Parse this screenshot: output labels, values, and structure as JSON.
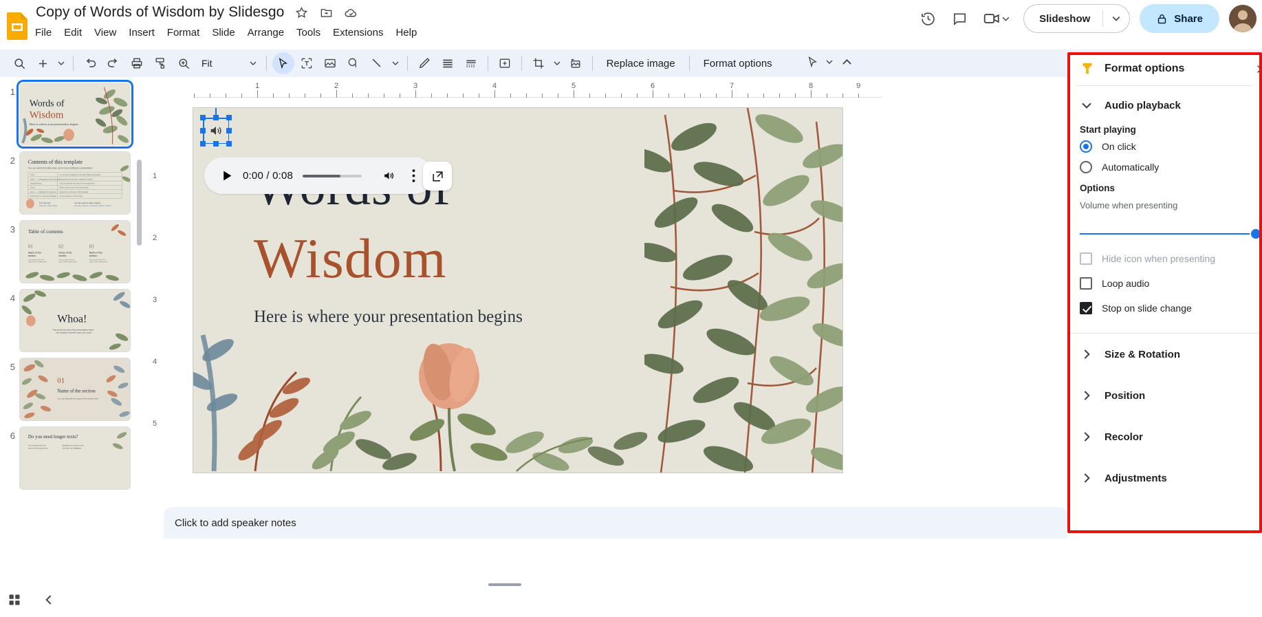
{
  "app": {
    "doc_title": "Copy of Words of Wisdom by Slidesgo",
    "title_icons": [
      "star-icon",
      "move-to-folder-icon",
      "cloud-saved-icon"
    ],
    "menus": [
      "File",
      "Edit",
      "View",
      "Insert",
      "Format",
      "Slide",
      "Arrange",
      "Tools",
      "Extensions",
      "Help"
    ],
    "top_right": {
      "history_icon": "version-history-icon",
      "comment_icon": "comment-icon",
      "meet_icon": "meet-camera-icon",
      "slideshow_label": "Slideshow",
      "share_label": "Share",
      "lock_icon": "lock-icon"
    }
  },
  "toolbar": {
    "zoom_value": "Fit",
    "icons": [
      "search-icon",
      "plus-new-slide-icon",
      "undo-icon",
      "redo-icon",
      "print-icon",
      "paint-format-icon",
      "zoom-icon"
    ],
    "tools": [
      "select-cursor-icon",
      "textbox-icon",
      "image-icon",
      "shape-icon",
      "line-icon",
      "pen-icon",
      "align-icon",
      "transition-icon"
    ],
    "image_tools": [
      "add-to-slide-icon",
      "crop-icon",
      "reset-image-icon"
    ],
    "replace_image_label": "Replace image",
    "format_options_label": "Format options",
    "cursor_mode_icon": "laser-pointer-icon",
    "collapse_icon": "chevron-up-icon"
  },
  "filmstrip": {
    "slides": [
      {
        "num": "1",
        "selected": true,
        "title1": "Words of",
        "title2": "Wisdom",
        "sub": "Here is where your presentation begins",
        "layout": "title"
      },
      {
        "num": "2",
        "selected": false,
        "title1": "Contents of this template",
        "sub": "You can delete this slide when you're done editing the presentation",
        "layout": "table"
      },
      {
        "num": "3",
        "selected": false,
        "title1": "Table of contents",
        "items": [
          "01",
          "02",
          "03"
        ],
        "itemtext": "Name of the section",
        "itemsub": "You can describe the topic of the section here",
        "layout": "toc"
      },
      {
        "num": "4",
        "selected": false,
        "title1": "Whoa!",
        "sub": "This can be the part of the presentation where you introduce yourself, write your email...",
        "layout": "statement"
      },
      {
        "num": "5",
        "selected": false,
        "title1": "01",
        "title2": "Name of the section",
        "sub": "You can describe the topic of the section here",
        "layout": "section"
      },
      {
        "num": "6",
        "selected": false,
        "title1": "Do you need longer texts?",
        "sub": "You can describe the topic of the section here",
        "layout": "text"
      }
    ]
  },
  "ruler": {
    "h_labels": [
      "1",
      "2",
      "3",
      "4",
      "5",
      "6",
      "7",
      "8",
      "9"
    ],
    "v_labels": [
      "1",
      "2",
      "3",
      "4",
      "5"
    ]
  },
  "slide": {
    "title_line1": "Words of",
    "title_line2": "Wisdom",
    "subtitle": "Here is where your presentation begins",
    "audio_icon": "speaker-audio-icon"
  },
  "player": {
    "play_icon": "play-icon",
    "time": "0:00 / 0:08",
    "progress_percent": 64,
    "volume_icon": "volume-icon",
    "menu_icon": "more-vertical-icon",
    "popout_icon": "open-in-new-icon"
  },
  "notes": {
    "placeholder": "Click to add speaker notes"
  },
  "bottom_left": {
    "grid_view_icon": "grid-view-icon",
    "collapse_icon": "chevron-left-icon"
  },
  "format_panel": {
    "header_title": "Format options",
    "header_icon": "format-paint-icon",
    "close_icon": "close-icon",
    "audio_section": {
      "title": "Audio playback",
      "expanded": true,
      "start_playing_label": "Start playing",
      "radios": [
        {
          "label": "On click",
          "checked": true
        },
        {
          "label": "Automatically",
          "checked": false
        }
      ],
      "options_label": "Options",
      "volume_label": "Volume when presenting",
      "volume_percent": 100,
      "checkboxes": [
        {
          "label": "Hide icon when presenting",
          "checked": false,
          "disabled": true
        },
        {
          "label": "Loop audio",
          "checked": false,
          "disabled": false
        },
        {
          "label": "Stop on slide change",
          "checked": true,
          "disabled": false
        }
      ]
    },
    "collapsed_sections": [
      {
        "title": "Size & Rotation"
      },
      {
        "title": "Position"
      },
      {
        "title": "Recolor"
      },
      {
        "title": "Adjustments"
      }
    ],
    "highlight_color": "#e8110f"
  },
  "colors": {
    "accent_blue": "#1a73e8",
    "toolbar_bg": "#edf2fa",
    "slide_bg": "#e6e4d8",
    "title_dark": "#1d2532",
    "title_rust": "#a8522d",
    "share_bg": "#c2e7ff"
  }
}
